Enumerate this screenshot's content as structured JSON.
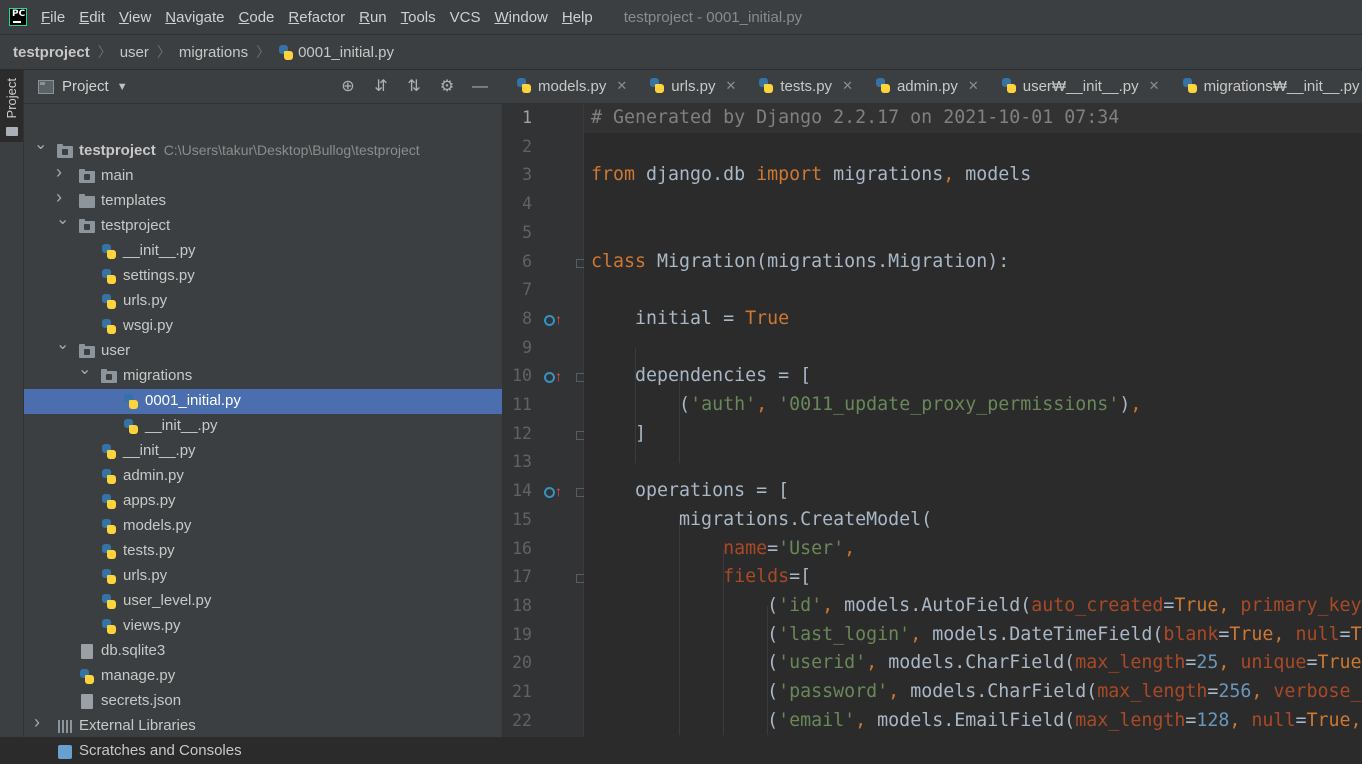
{
  "app": {
    "logo_text": "PC",
    "window_title": "testproject - 0001_initial.py"
  },
  "menu": [
    {
      "label": "File"
    },
    {
      "label": "Edit"
    },
    {
      "label": "View"
    },
    {
      "label": "Navigate"
    },
    {
      "label": "Code"
    },
    {
      "label": "Refactor"
    },
    {
      "label": "Run"
    },
    {
      "label": "Tools"
    },
    {
      "label": "VCS"
    },
    {
      "label": "Window"
    },
    {
      "label": "Help"
    }
  ],
  "breadcrumb": [
    "testproject",
    "user",
    "migrations",
    "0001_initial.py"
  ],
  "toolstrip": {
    "project_label": "Project"
  },
  "project_panel": {
    "title": "Project",
    "tools": [
      {
        "name": "locate-icon",
        "glyph": "⊕"
      },
      {
        "name": "expand-all-icon",
        "glyph": "⇵"
      },
      {
        "name": "collapse-all-icon",
        "glyph": "⇅"
      },
      {
        "name": "gear-icon",
        "glyph": "⚙"
      },
      {
        "name": "minimize-icon",
        "glyph": "—"
      }
    ]
  },
  "tree": [
    {
      "label": "testproject",
      "path": "C:\\Users\\takur\\Desktop\\Bullog\\testproject",
      "depth": 0,
      "type": "folder",
      "expanded": true,
      "bold": true
    },
    {
      "label": "main",
      "depth": 1,
      "type": "folder",
      "expanded": false
    },
    {
      "label": "templates",
      "depth": 1,
      "type": "folder-plain",
      "expanded": false
    },
    {
      "label": "testproject",
      "depth": 1,
      "type": "folder",
      "expanded": true
    },
    {
      "label": "__init__.py",
      "depth": 2,
      "type": "py"
    },
    {
      "label": "settings.py",
      "depth": 2,
      "type": "py"
    },
    {
      "label": "urls.py",
      "depth": 2,
      "type": "py"
    },
    {
      "label": "wsgi.py",
      "depth": 2,
      "type": "py"
    },
    {
      "label": "user",
      "depth": 1,
      "type": "folder",
      "expanded": true
    },
    {
      "label": "migrations",
      "depth": 2,
      "type": "folder",
      "expanded": true
    },
    {
      "label": "0001_initial.py",
      "depth": 3,
      "type": "py",
      "selected": true
    },
    {
      "label": "__init__.py",
      "depth": 3,
      "type": "py"
    },
    {
      "label": "__init__.py",
      "depth": 2,
      "type": "py"
    },
    {
      "label": "admin.py",
      "depth": 2,
      "type": "py"
    },
    {
      "label": "apps.py",
      "depth": 2,
      "type": "py"
    },
    {
      "label": "models.py",
      "depth": 2,
      "type": "py"
    },
    {
      "label": "tests.py",
      "depth": 2,
      "type": "py"
    },
    {
      "label": "urls.py",
      "depth": 2,
      "type": "py"
    },
    {
      "label": "user_level.py",
      "depth": 2,
      "type": "py"
    },
    {
      "label": "views.py",
      "depth": 2,
      "type": "py"
    },
    {
      "label": "db.sqlite3",
      "depth": 1,
      "type": "gen"
    },
    {
      "label": "manage.py",
      "depth": 1,
      "type": "py"
    },
    {
      "label": "secrets.json",
      "depth": 1,
      "type": "gen"
    },
    {
      "label": "External Libraries",
      "depth": 0,
      "type": "lib",
      "expanded": false
    },
    {
      "label": "Scratches and Consoles",
      "depth": 0,
      "type": "scratch"
    }
  ],
  "tabs": [
    {
      "label": "models.py",
      "closable": true
    },
    {
      "label": "urls.py",
      "closable": true
    },
    {
      "label": "tests.py",
      "closable": true
    },
    {
      "label": "admin.py",
      "closable": true
    },
    {
      "label": "user₩__init__.py",
      "closable": true
    },
    {
      "label": "migrations₩__init__.py",
      "closable": true
    }
  ],
  "editor": {
    "current_line": 1,
    "lines": [
      {
        "n": 1,
        "tokens": [
          [
            "c-com",
            "# Generated by Django 2.2.17 on 2021-10-01 07:34"
          ]
        ]
      },
      {
        "n": 2,
        "tokens": []
      },
      {
        "n": 3,
        "tokens": [
          [
            "c-kw",
            "from "
          ],
          [
            "c-def",
            "django.db "
          ],
          [
            "c-kw",
            "import "
          ],
          [
            "c-def",
            "migrations"
          ],
          [
            "c-kw",
            ", "
          ],
          [
            "c-def",
            "models"
          ]
        ]
      },
      {
        "n": 4,
        "tokens": []
      },
      {
        "n": 5,
        "tokens": []
      },
      {
        "n": 6,
        "fold": true,
        "tokens": [
          [
            "c-kw",
            "class "
          ],
          [
            "c-def",
            "Migration(migrations.Migration):"
          ]
        ]
      },
      {
        "n": 7,
        "tokens": []
      },
      {
        "n": 8,
        "mark": true,
        "tokens": [
          [
            "c-def",
            "    initial = "
          ],
          [
            "c-kw",
            "True"
          ]
        ]
      },
      {
        "n": 9,
        "tokens": []
      },
      {
        "n": 10,
        "mark": true,
        "fold": true,
        "tokens": [
          [
            "c-def",
            "    dependencies = ["
          ]
        ]
      },
      {
        "n": 11,
        "tokens": [
          [
            "c-def",
            "        ("
          ],
          [
            "c-str",
            "'auth'"
          ],
          [
            "c-kw",
            ", "
          ],
          [
            "c-str",
            "'0011_update_proxy_permissions'"
          ],
          [
            "c-def",
            ")"
          ],
          [
            "c-kw",
            ","
          ]
        ]
      },
      {
        "n": 12,
        "fold": true,
        "tokens": [
          [
            "c-def",
            "    ]"
          ]
        ]
      },
      {
        "n": 13,
        "tokens": []
      },
      {
        "n": 14,
        "mark": true,
        "fold": true,
        "tokens": [
          [
            "c-def",
            "    operations = ["
          ]
        ]
      },
      {
        "n": 15,
        "tokens": [
          [
            "c-def",
            "        migrations.CreateModel("
          ]
        ]
      },
      {
        "n": 16,
        "tokens": [
          [
            "c-def",
            "            "
          ],
          [
            "c-prm",
            "name"
          ],
          [
            "c-def",
            "="
          ],
          [
            "c-str",
            "'User'"
          ],
          [
            "c-kw",
            ","
          ]
        ]
      },
      {
        "n": 17,
        "fold": true,
        "tokens": [
          [
            "c-def",
            "            "
          ],
          [
            "c-prm",
            "fields"
          ],
          [
            "c-def",
            "=["
          ]
        ]
      },
      {
        "n": 18,
        "tokens": [
          [
            "c-def",
            "                ("
          ],
          [
            "c-str",
            "'id'"
          ],
          [
            "c-kw",
            ", "
          ],
          [
            "c-def",
            "models.AutoField("
          ],
          [
            "c-prm",
            "auto_created"
          ],
          [
            "c-def",
            "="
          ],
          [
            "c-kw",
            "True"
          ],
          [
            "c-kw",
            ", "
          ],
          [
            "c-prm",
            "primary_key"
          ]
        ]
      },
      {
        "n": 19,
        "tokens": [
          [
            "c-def",
            "                ("
          ],
          [
            "c-str",
            "'last_login'"
          ],
          [
            "c-kw",
            ", "
          ],
          [
            "c-def",
            "models.DateTimeField("
          ],
          [
            "c-prm",
            "blank"
          ],
          [
            "c-def",
            "="
          ],
          [
            "c-kw",
            "True"
          ],
          [
            "c-kw",
            ", "
          ],
          [
            "c-prm",
            "null"
          ],
          [
            "c-def",
            "="
          ],
          [
            "c-kw",
            "T"
          ]
        ]
      },
      {
        "n": 20,
        "tokens": [
          [
            "c-def",
            "                ("
          ],
          [
            "c-str",
            "'userid'"
          ],
          [
            "c-kw",
            ", "
          ],
          [
            "c-def",
            "models.CharField("
          ],
          [
            "c-prm",
            "max_length"
          ],
          [
            "c-def",
            "="
          ],
          [
            "c-num",
            "25"
          ],
          [
            "c-kw",
            ", "
          ],
          [
            "c-prm",
            "unique"
          ],
          [
            "c-def",
            "="
          ],
          [
            "c-kw",
            "True"
          ]
        ]
      },
      {
        "n": 21,
        "tokens": [
          [
            "c-def",
            "                ("
          ],
          [
            "c-str",
            "'password'"
          ],
          [
            "c-kw",
            ", "
          ],
          [
            "c-def",
            "models.CharField("
          ],
          [
            "c-prm",
            "max_length"
          ],
          [
            "c-def",
            "="
          ],
          [
            "c-num",
            "256"
          ],
          [
            "c-kw",
            ", "
          ],
          [
            "c-prm",
            "verbose_"
          ]
        ]
      },
      {
        "n": 22,
        "tokens": [
          [
            "c-def",
            "                ("
          ],
          [
            "c-str",
            "'email'"
          ],
          [
            "c-kw",
            ", "
          ],
          [
            "c-def",
            "models.EmailField("
          ],
          [
            "c-prm",
            "max_length"
          ],
          [
            "c-def",
            "="
          ],
          [
            "c-num",
            "128"
          ],
          [
            "c-kw",
            ", "
          ],
          [
            "c-prm",
            "null"
          ],
          [
            "c-def",
            "="
          ],
          [
            "c-kw",
            "True"
          ],
          [
            "c-kw",
            ","
          ]
        ]
      }
    ]
  }
}
